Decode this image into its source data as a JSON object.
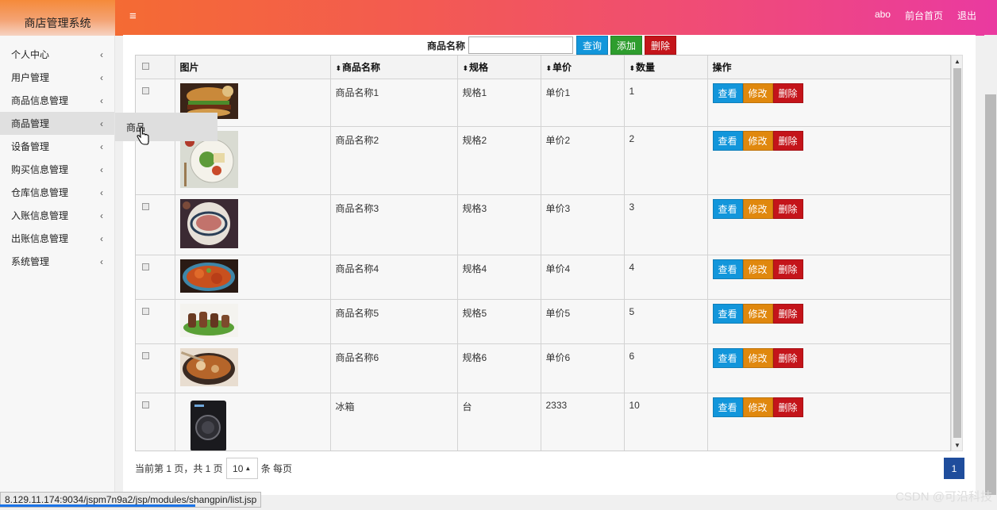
{
  "brand": {
    "title": "商店管理系统"
  },
  "header": {
    "menu_icon": "≡",
    "user": "abo",
    "frontend_link": "前台首页",
    "logout": "退出"
  },
  "sidebar": {
    "items": [
      {
        "label": "个人中心"
      },
      {
        "label": "用户管理"
      },
      {
        "label": "商品信息管理"
      },
      {
        "label": "商品管理"
      },
      {
        "label": "设备管理"
      },
      {
        "label": "购买信息管理"
      },
      {
        "label": "仓库信息管理"
      },
      {
        "label": "入账信息管理"
      },
      {
        "label": "出账信息管理"
      },
      {
        "label": "系统管理"
      }
    ],
    "chevron": "‹",
    "submenu_item": "商品"
  },
  "search": {
    "label": "商品名称",
    "value": "",
    "query_btn": "查询",
    "add_btn": "添加",
    "delete_btn": "删除"
  },
  "table": {
    "headers": {
      "image": "图片",
      "name": "商品名称",
      "spec": "规格",
      "price": "单价",
      "qty": "数量",
      "ops": "操作"
    },
    "sort_glyph": "⬍",
    "rows": [
      {
        "name": "商品名称1",
        "spec": "规格1",
        "price": "单价1",
        "qty": "1",
        "image": "burger"
      },
      {
        "name": "商品名称2",
        "spec": "规格2",
        "price": "单价2",
        "qty": "2",
        "image": "salad-plate"
      },
      {
        "name": "商品名称3",
        "spec": "规格3",
        "price": "单价3",
        "qty": "3",
        "image": "steak-plate"
      },
      {
        "name": "商品名称4",
        "spec": "规格4",
        "price": "单价4",
        "qty": "4",
        "image": "crab-dish"
      },
      {
        "name": "商品名称5",
        "spec": "规格5",
        "price": "单价5",
        "qty": "5",
        "image": "skewers"
      },
      {
        "name": "商品名称6",
        "spec": "规格6",
        "price": "单价6",
        "qty": "6",
        "image": "soup-bowl"
      },
      {
        "name": "冰箱",
        "spec": "台",
        "price": "2333",
        "qty": "10",
        "image": "appliance"
      }
    ],
    "row_actions": {
      "view": "查看",
      "edit": "修改",
      "delete": "删除"
    }
  },
  "pagination": {
    "summary": "当前第 1 页，共 1 页",
    "page_size": "10",
    "per_page_suffix": "条 每页",
    "current_page": "1"
  },
  "status_bar": {
    "url": "8.129.11.174:9034/jspm7n9a2/jsp/modules/shangpin/list.jsp"
  },
  "watermark": "CSDN @可沿科技",
  "colors": {
    "header_start": "#f46b33",
    "header_end": "#ea3aa0",
    "btn_view": "#1296db",
    "btn_edit": "#e0880e",
    "btn_delete": "#c4141a",
    "btn_add": "#2e9d2e",
    "page_active": "#1f4d9c"
  }
}
